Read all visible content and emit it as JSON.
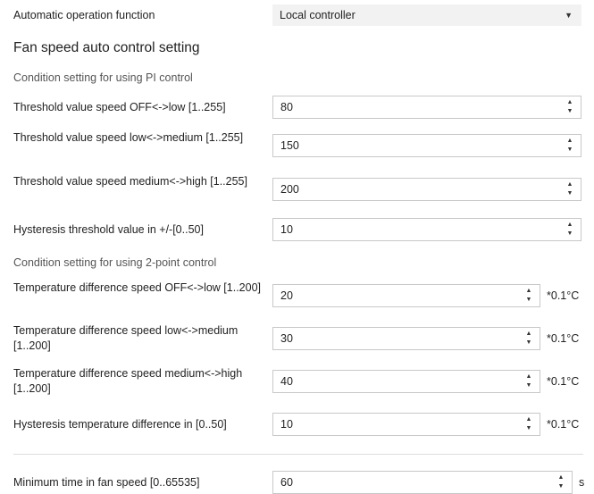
{
  "operation": {
    "label": "Automatic operation function",
    "value": "Local controller"
  },
  "section_title": "Fan speed auto control setting",
  "pi_group": {
    "title": "Condition setting for using PI control",
    "rows": [
      {
        "label": "Threshold value speed OFF<->low [1..255]",
        "value": "80"
      },
      {
        "label": "Threshold value speed low<->medium [1..255]",
        "value": "150"
      },
      {
        "label": "Threshold value speed medium<->high [1..255]",
        "value": "200"
      },
      {
        "label": "Hysteresis threshold value in +/-[0..50]",
        "value": "10"
      }
    ]
  },
  "twopoint_group": {
    "title": "Condition setting for using 2-point control",
    "unit": "*0.1°C",
    "rows": [
      {
        "label": "Temperature difference speed OFF<->low [1..200]",
        "value": "20"
      },
      {
        "label": "Temperature difference speed low<->medium [1..200]",
        "value": "30"
      },
      {
        "label": "Temperature difference speed medium<->high [1..200]",
        "value": "40"
      },
      {
        "label": "Hysteresis temperature difference in [0..50]",
        "value": "10"
      }
    ]
  },
  "min_time": {
    "label": "Minimum time in fan speed [0..65535]",
    "value": "60",
    "unit": "s"
  },
  "icons": {
    "spin_up": "▲",
    "spin_down": "▼",
    "dropdown": "▼"
  }
}
